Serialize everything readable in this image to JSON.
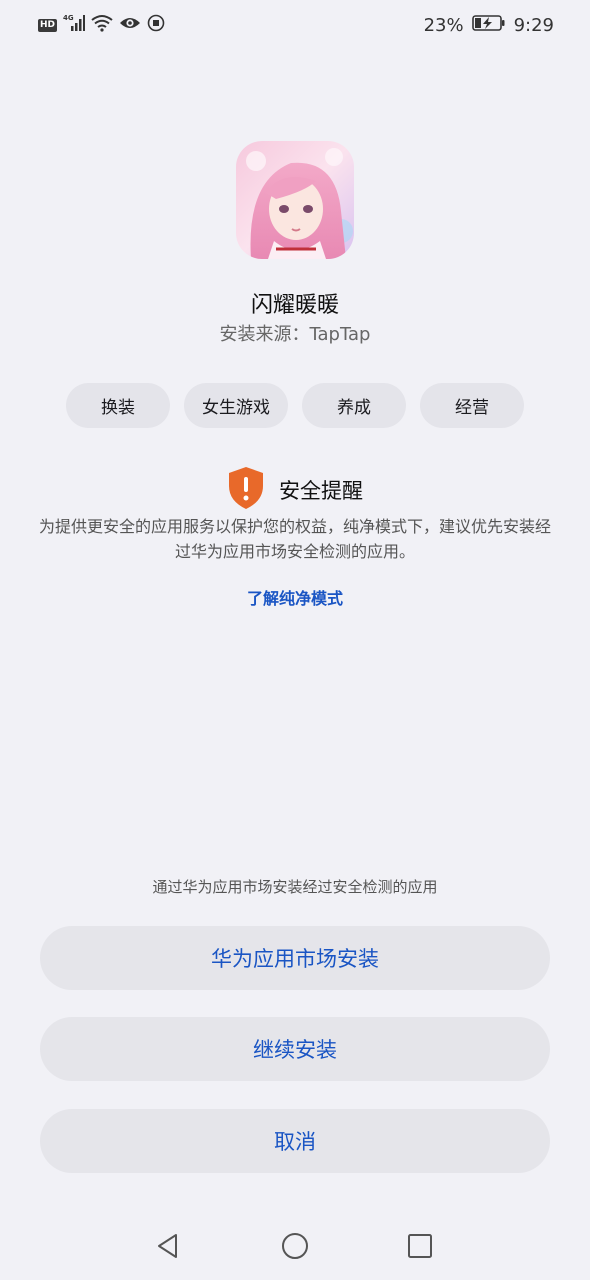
{
  "status_bar": {
    "hd": "HD",
    "network": "4G",
    "battery": "23%",
    "time": "9:29"
  },
  "app": {
    "name": "闪耀暖暖",
    "source": "安装来源：TapTap"
  },
  "tags": [
    "换装",
    "女生游戏",
    "养成",
    "经营"
  ],
  "security": {
    "title": "安全提醒",
    "description": "为提供更安全的应用服务以保护您的权益，纯净模式下，建议优先安装经过华为应用市场安全检测的应用。",
    "link": "了解纯净模式",
    "accent_color": "#e8692a"
  },
  "bottom": {
    "hint": "通过华为应用市场安装经过安全检测的应用",
    "buttons": {
      "market_install": "华为应用市场安装",
      "continue_install": "继续安装",
      "cancel": "取消"
    },
    "button_color": "#1a55c4"
  },
  "nav": {
    "icons": [
      "back-icon",
      "home-icon",
      "recent-apps-icon"
    ]
  }
}
